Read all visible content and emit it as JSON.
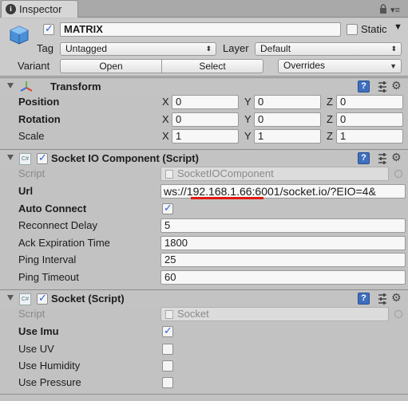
{
  "tab": {
    "label": "Inspector"
  },
  "header": {
    "object_name": "MATRIX",
    "static_label": "Static",
    "tag_label": "Tag",
    "tag_value": "Untagged",
    "layer_label": "Layer",
    "layer_value": "Default",
    "variant_label": "Variant",
    "open_label": "Open",
    "select_label": "Select",
    "overrides_label": "Overrides"
  },
  "transform": {
    "title": "Transform",
    "rows": [
      {
        "label": "Position",
        "x": "0",
        "y": "0",
        "z": "0"
      },
      {
        "label": "Rotation",
        "x": "0",
        "y": "0",
        "z": "0"
      },
      {
        "label": "Scale",
        "x": "1",
        "y": "1",
        "z": "1"
      }
    ],
    "axes": {
      "x": "X",
      "y": "Y",
      "z": "Z"
    }
  },
  "socketio": {
    "title": "Socket IO Component (Script)",
    "script_label": "Script",
    "script_value": "SocketIOComponent",
    "url_label": "Url",
    "url_prefix": "ws://",
    "url_host": "192.168.1.66",
    "url_rest": ":6001/socket.io/?EIO=4&",
    "auto_connect_label": "Auto Connect",
    "auto_connect": true,
    "reconnect_label": "Reconnect Delay",
    "reconnect_value": "5",
    "ack_label": "Ack Expiration Time",
    "ack_value": "1800",
    "ping_interval_label": "Ping Interval",
    "ping_interval_value": "25",
    "ping_timeout_label": "Ping Timeout",
    "ping_timeout_value": "60"
  },
  "socket": {
    "title": "Socket (Script)",
    "script_label": "Script",
    "script_value": "Socket",
    "use_imu_label": "Use Imu",
    "use_imu": true,
    "use_uv_label": "Use UV",
    "use_uv": false,
    "use_humidity_label": "Use Humidity",
    "use_humidity": false,
    "use_pressure_label": "Use Pressure",
    "use_pressure": false
  },
  "colors": {
    "accent": "#2f63d6",
    "url_highlight": "#e01a10",
    "background": "#c2c2c2"
  }
}
